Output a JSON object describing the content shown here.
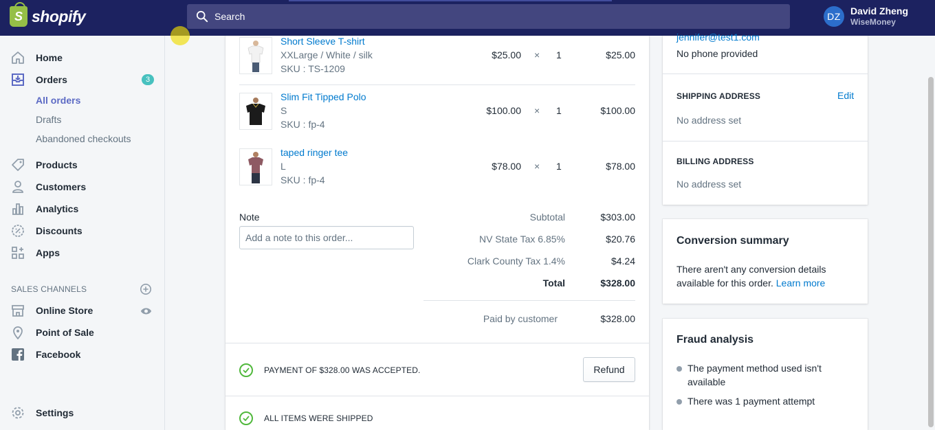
{
  "topbar": {
    "logo_text": "shopify",
    "logo_letter": "S",
    "search_placeholder": "Search",
    "user_initials": "DZ",
    "user_name": "David Zheng",
    "store_name": "WiseMoney"
  },
  "sidebar": {
    "items": [
      {
        "label": "Home",
        "icon": "home-icon"
      },
      {
        "label": "Orders",
        "icon": "orders-icon",
        "badge": "3"
      },
      {
        "label": "Products",
        "icon": "tag-icon"
      },
      {
        "label": "Customers",
        "icon": "person-icon"
      },
      {
        "label": "Analytics",
        "icon": "bar-chart-icon"
      },
      {
        "label": "Discounts",
        "icon": "discount-icon"
      },
      {
        "label": "Apps",
        "icon": "apps-icon"
      }
    ],
    "order_subitems": [
      "All orders",
      "Drafts",
      "Abandoned checkouts"
    ],
    "sales_channels_label": "SALES CHANNELS",
    "channels": [
      {
        "label": "Online Store",
        "icon": "store-icon"
      },
      {
        "label": "Point of Sale",
        "icon": "location-pin-icon"
      },
      {
        "label": "Facebook",
        "icon": "facebook-icon"
      }
    ],
    "settings_label": "Settings"
  },
  "line_items": [
    {
      "name": "Short Sleeve T-shirt",
      "variant": "XXLarge / White / silk",
      "sku": "SKU : TS-1209",
      "price": "$25.00",
      "times": "×",
      "qty": "1",
      "total": "$25.00",
      "shirt_color": "#f2f2f2"
    },
    {
      "name": "Slim Fit Tipped Polo",
      "variant": "S",
      "sku": "SKU : fp-4",
      "price": "$100.00",
      "times": "×",
      "qty": "1",
      "total": "$100.00",
      "shirt_color": "#1b1b1b"
    },
    {
      "name": "taped ringer tee",
      "variant": "L",
      "sku": "SKU : fp-4",
      "price": "$78.00",
      "times": "×",
      "qty": "1",
      "total": "$78.00",
      "shirt_color": "#8e5a63"
    }
  ],
  "note": {
    "label": "Note",
    "placeholder": "Add a note to this order..."
  },
  "summary": {
    "subtotal_label": "Subtotal",
    "subtotal": "$303.00",
    "tax1_label": "NV State Tax 6.85%",
    "tax1": "$20.76",
    "tax2_label": "Clark County Tax 1.4%",
    "tax2": "$4.24",
    "total_label": "Total",
    "total": "$328.00",
    "paid_label": "Paid by customer",
    "paid": "$328.00"
  },
  "payment": {
    "status": "PAYMENT OF $328.00 WAS ACCEPTED.",
    "refund_label": "Refund"
  },
  "fulfillment": {
    "status": "ALL ITEMS WERE SHIPPED"
  },
  "customer": {
    "email": "jennifer@test1.com",
    "phone": "No phone provided",
    "shipping_heading": "SHIPPING ADDRESS",
    "edit_label": "Edit",
    "shipping_value": "No address set",
    "billing_heading": "BILLING ADDRESS",
    "billing_value": "No address set"
  },
  "conversion": {
    "title": "Conversion summary",
    "text": "There aren't any conversion details available for this order.",
    "link": "Learn more"
  },
  "fraud": {
    "title": "Fraud analysis",
    "points": [
      "The payment method used isn't available",
      "There was 1 payment attempt"
    ]
  },
  "colors": {
    "topbar": "#1c2260",
    "link": "#007ace",
    "success": "#50b83c",
    "badge": "#47c1bf",
    "nav_active": "#5c6ac4"
  }
}
